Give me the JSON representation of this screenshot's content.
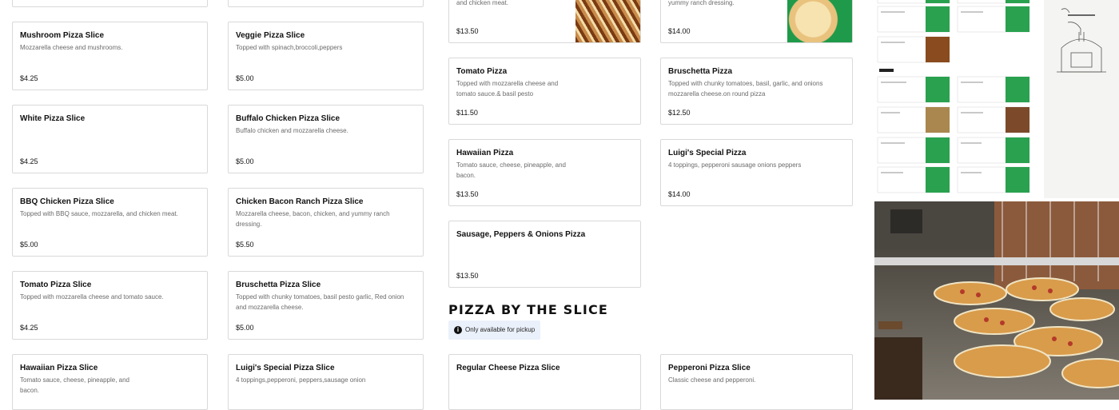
{
  "slices_column": [
    {
      "title": "Mushroom Pizza Slice",
      "desc": "Mozzarella cheese and mushrooms.",
      "price": "$4.25"
    },
    {
      "title": "White Pizza Slice",
      "desc": "",
      "price": "$4.25"
    },
    {
      "title": "BBQ Chicken Pizza Slice",
      "desc": "Topped with BBQ sauce, mozzarella, and chicken meat.",
      "price": "$5.00"
    },
    {
      "title": "Tomato Pizza Slice",
      "desc": "Topped with mozzarella cheese and tomato sauce.",
      "price": "$4.25"
    },
    {
      "title": "Hawaiian Pizza Slice",
      "desc": "Tomato sauce, cheese, pineapple, and bacon.",
      "price": ""
    }
  ],
  "slices_column2": [
    {
      "title": "Veggie Pizza Slice",
      "desc": "Topped with spinach,broccoli,peppers",
      "price": "$5.00"
    },
    {
      "title": "Buffalo Chicken Pizza Slice",
      "desc": "Buffalo chicken and mozzarella cheese.",
      "price": "$5.00"
    },
    {
      "title": "Chicken Bacon Ranch Pizza Slice",
      "desc": "Mozzarella cheese, bacon, chicken, and yummy ranch dressing.",
      "price": "$5.50"
    },
    {
      "title": "Bruschetta Pizza Slice",
      "desc": "Topped with chunky tomatoes, basil pesto garlic, Red onion and mozzarella cheese.",
      "price": "$5.00"
    },
    {
      "title": "Luigi's Special Pizza Slice",
      "desc": "4 toppings,pepperoni, peppers,sausage onion",
      "price": ""
    }
  ],
  "pizzas": {
    "top_left": {
      "desc": "Topped with BBQ sauce, mozzarella, and chicken meat.",
      "price": "$13.50"
    },
    "top_right": {
      "desc": "Mozzarella cheese, bacon, chicken, and yummy ranch dressing.",
      "price": "$14.00"
    },
    "tomato": {
      "title": "Tomato Pizza",
      "desc": "Topped with mozzarella cheese and tomato sauce.& basil pesto",
      "price": "$11.50"
    },
    "bruschetta": {
      "title": "Bruschetta Pizza",
      "desc": "Topped with chunky tomatoes, basil, garlic, and onions mozzarella cheese.on round pizza",
      "price": "$12.50"
    },
    "hawaiian": {
      "title": "Hawaiian Pizza",
      "desc": "Tomato sauce, cheese, pineapple, and bacon.",
      "price": "$13.50"
    },
    "luigi": {
      "title": "Luigi's Special Pizza",
      "desc": "4 toppings, pepperoni sausage onions peppers",
      "price": "$14.00"
    },
    "sausage": {
      "title": "Sausage, Peppers & Onions Pizza",
      "desc": "",
      "price": "$13.50"
    }
  },
  "section": {
    "heading": "PIZZA BY THE SLICE",
    "pickup_note": "Only available for pickup"
  },
  "slice_bottom": [
    {
      "title": "Regular Cheese Pizza Slice",
      "desc": ""
    },
    {
      "title": "Pepperoni Pizza Slice",
      "desc": "Classic cheese and pepperoni."
    }
  ],
  "colors": {
    "accent_bg": "#ebf1fb",
    "border": "#d9d9d9",
    "muted_text": "#6b6b6b"
  },
  "icons": {
    "info": "info-icon"
  }
}
